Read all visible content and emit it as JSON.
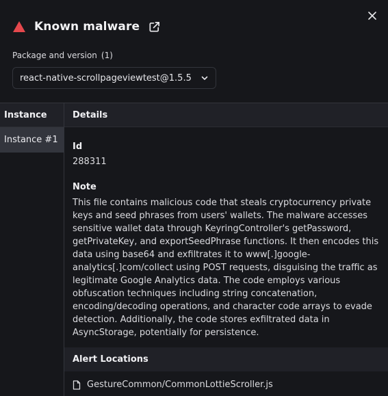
{
  "header": {
    "title": "Known malware",
    "warning_icon": "warning-triangle-icon",
    "external_icon": "external-link-icon",
    "close_icon": "close-icon",
    "accent_color": "#e5484d"
  },
  "package": {
    "label": "Package and version",
    "count": "(1)",
    "selected": "react-native-scrollpageviewtest@1.5.5"
  },
  "instances": {
    "header": "Instance",
    "items": [
      {
        "label": "Instance #1"
      }
    ]
  },
  "details": {
    "header": "Details",
    "id_label": "Id",
    "id_value": "288311",
    "note_label": "Note",
    "note_text": "This file contains malicious code that steals cryptocurrency private keys and seed phrases from users' wallets. The malware accesses sensitive wallet data through KeyringController's getPassword, getPrivateKey, and exportSeedPhrase functions. It then encodes this data using base64 and exfiltrates it to www[.]google-analytics[.]com/collect using POST requests, disguising the traffic as legitimate Google Analytics data. The code employs various obfuscation techniques including string concatenation, encoding/decoding operations, and character code arrays to evade detection. Additionally, the code stores exfiltrated data in AsyncStorage, potentially for persistence."
  },
  "alerts": {
    "header": "Alert Locations",
    "items": [
      {
        "path": "GestureCommon/CommonLottieScroller.js",
        "icon": "file-icon"
      }
    ]
  }
}
